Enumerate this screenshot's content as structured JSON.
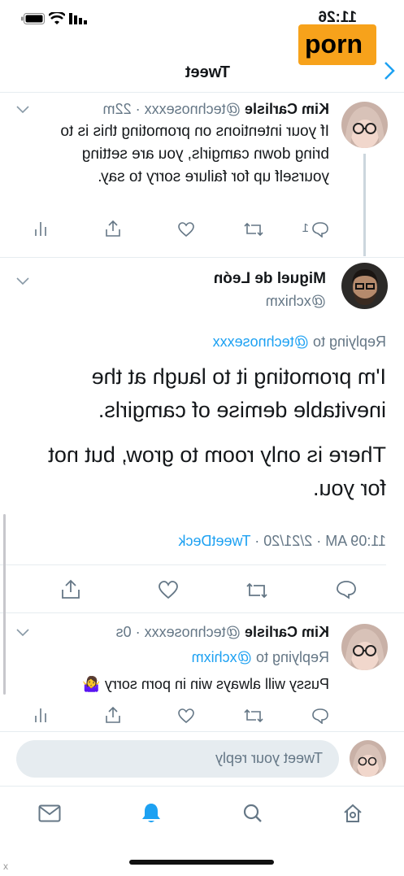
{
  "status_bar": {
    "time": "11:26"
  },
  "watermark": {
    "text": "porn"
  },
  "header": {
    "title": "Tweet"
  },
  "parent_tweet": {
    "name": "Kim Carlisle",
    "handle": "@technosexxx",
    "dot": "·",
    "time": "22m",
    "text": "If your intentions on promoting this is to bring down camgirls, you are setting yourself up for failure sorry to say.",
    "reply_count": "1"
  },
  "main_tweet": {
    "name": "Miguel de León",
    "handle": "@xchixm",
    "replying_prefix": "Replying to",
    "replying_handle": "@technosexxx",
    "paragraph1": "I'm promoting it to laugh at the inevitable demise of camgirls.",
    "paragraph2": "There is only room to grow, but not for you.",
    "timestamp": "11:09 AM · 2/21/20 ·",
    "source": "TweetDeck"
  },
  "reply_tweet": {
    "name": "Kim Carlisle",
    "handle": "@technosexxx",
    "dot": "·",
    "time": "0s",
    "replying_prefix": "Replying to",
    "replying_handle": "@xchixm",
    "text": "Pussy will always win in porn sorry",
    "emoji": "🤷‍♀️"
  },
  "composer": {
    "placeholder": "Tweet your reply"
  },
  "bottom_nav": {
    "items": [
      "home-icon",
      "search-icon",
      "notifications-icon",
      "messages-icon"
    ]
  },
  "corner_mark": "x",
  "colors": {
    "accent": "#1da1f2",
    "secondary_text": "#657786",
    "divider": "#e6ecf0",
    "watermark_bg": "#f7a21b"
  }
}
